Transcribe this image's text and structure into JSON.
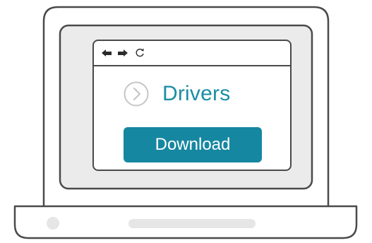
{
  "browser": {
    "toolbar_icons": [
      "back-arrow-icon",
      "forward-arrow-icon",
      "refresh-icon"
    ]
  },
  "content": {
    "title": "Drivers",
    "title_icon": "chevron-right-circle-icon",
    "download_label": "Download"
  },
  "colors": {
    "outline": "#4a4a4a",
    "screen_background": "#ebebeb",
    "accent": "#1687a0",
    "title_text": "#1a8ea3",
    "chevron_gray": "#c6c6c6",
    "base_details": "#e6e6e6",
    "background": "#ffffff"
  }
}
